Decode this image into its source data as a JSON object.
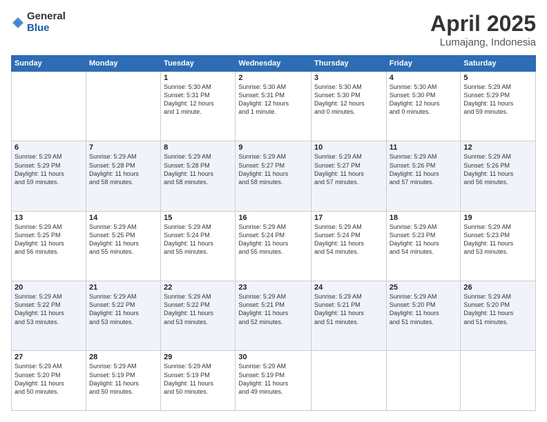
{
  "logo": {
    "general": "General",
    "blue": "Blue"
  },
  "title": "April 2025",
  "location": "Lumajang, Indonesia",
  "headers": [
    "Sunday",
    "Monday",
    "Tuesday",
    "Wednesday",
    "Thursday",
    "Friday",
    "Saturday"
  ],
  "weeks": [
    {
      "stripe": false,
      "days": [
        {
          "num": "",
          "info": ""
        },
        {
          "num": "",
          "info": ""
        },
        {
          "num": "1",
          "info": "Sunrise: 5:30 AM\nSunset: 5:31 PM\nDaylight: 12 hours\nand 1 minute."
        },
        {
          "num": "2",
          "info": "Sunrise: 5:30 AM\nSunset: 5:31 PM\nDaylight: 12 hours\nand 1 minute."
        },
        {
          "num": "3",
          "info": "Sunrise: 5:30 AM\nSunset: 5:30 PM\nDaylight: 12 hours\nand 0 minutes."
        },
        {
          "num": "4",
          "info": "Sunrise: 5:30 AM\nSunset: 5:30 PM\nDaylight: 12 hours\nand 0 minutes."
        },
        {
          "num": "5",
          "info": "Sunrise: 5:29 AM\nSunset: 5:29 PM\nDaylight: 11 hours\nand 59 minutes."
        }
      ]
    },
    {
      "stripe": true,
      "days": [
        {
          "num": "6",
          "info": "Sunrise: 5:29 AM\nSunset: 5:29 PM\nDaylight: 11 hours\nand 59 minutes."
        },
        {
          "num": "7",
          "info": "Sunrise: 5:29 AM\nSunset: 5:28 PM\nDaylight: 11 hours\nand 58 minutes."
        },
        {
          "num": "8",
          "info": "Sunrise: 5:29 AM\nSunset: 5:28 PM\nDaylight: 11 hours\nand 58 minutes."
        },
        {
          "num": "9",
          "info": "Sunrise: 5:29 AM\nSunset: 5:27 PM\nDaylight: 11 hours\nand 58 minutes."
        },
        {
          "num": "10",
          "info": "Sunrise: 5:29 AM\nSunset: 5:27 PM\nDaylight: 11 hours\nand 57 minutes."
        },
        {
          "num": "11",
          "info": "Sunrise: 5:29 AM\nSunset: 5:26 PM\nDaylight: 11 hours\nand 57 minutes."
        },
        {
          "num": "12",
          "info": "Sunrise: 5:29 AM\nSunset: 5:26 PM\nDaylight: 11 hours\nand 56 minutes."
        }
      ]
    },
    {
      "stripe": false,
      "days": [
        {
          "num": "13",
          "info": "Sunrise: 5:29 AM\nSunset: 5:25 PM\nDaylight: 11 hours\nand 56 minutes."
        },
        {
          "num": "14",
          "info": "Sunrise: 5:29 AM\nSunset: 5:25 PM\nDaylight: 11 hours\nand 55 minutes."
        },
        {
          "num": "15",
          "info": "Sunrise: 5:29 AM\nSunset: 5:24 PM\nDaylight: 11 hours\nand 55 minutes."
        },
        {
          "num": "16",
          "info": "Sunrise: 5:29 AM\nSunset: 5:24 PM\nDaylight: 11 hours\nand 55 minutes."
        },
        {
          "num": "17",
          "info": "Sunrise: 5:29 AM\nSunset: 5:24 PM\nDaylight: 11 hours\nand 54 minutes."
        },
        {
          "num": "18",
          "info": "Sunrise: 5:29 AM\nSunset: 5:23 PM\nDaylight: 11 hours\nand 54 minutes."
        },
        {
          "num": "19",
          "info": "Sunrise: 5:29 AM\nSunset: 5:23 PM\nDaylight: 11 hours\nand 53 minutes."
        }
      ]
    },
    {
      "stripe": true,
      "days": [
        {
          "num": "20",
          "info": "Sunrise: 5:29 AM\nSunset: 5:22 PM\nDaylight: 11 hours\nand 53 minutes."
        },
        {
          "num": "21",
          "info": "Sunrise: 5:29 AM\nSunset: 5:22 PM\nDaylight: 11 hours\nand 53 minutes."
        },
        {
          "num": "22",
          "info": "Sunrise: 5:29 AM\nSunset: 5:22 PM\nDaylight: 11 hours\nand 53 minutes."
        },
        {
          "num": "23",
          "info": "Sunrise: 5:29 AM\nSunset: 5:21 PM\nDaylight: 11 hours\nand 52 minutes."
        },
        {
          "num": "24",
          "info": "Sunrise: 5:29 AM\nSunset: 5:21 PM\nDaylight: 11 hours\nand 51 minutes."
        },
        {
          "num": "25",
          "info": "Sunrise: 5:29 AM\nSunset: 5:20 PM\nDaylight: 11 hours\nand 51 minutes."
        },
        {
          "num": "26",
          "info": "Sunrise: 5:29 AM\nSunset: 5:20 PM\nDaylight: 11 hours\nand 51 minutes."
        }
      ]
    },
    {
      "stripe": false,
      "days": [
        {
          "num": "27",
          "info": "Sunrise: 5:29 AM\nSunset: 5:20 PM\nDaylight: 11 hours\nand 50 minutes."
        },
        {
          "num": "28",
          "info": "Sunrise: 5:29 AM\nSunset: 5:19 PM\nDaylight: 11 hours\nand 50 minutes."
        },
        {
          "num": "29",
          "info": "Sunrise: 5:29 AM\nSunset: 5:19 PM\nDaylight: 11 hours\nand 50 minutes."
        },
        {
          "num": "30",
          "info": "Sunrise: 5:29 AM\nSunset: 5:19 PM\nDaylight: 11 hours\nand 49 minutes."
        },
        {
          "num": "",
          "info": ""
        },
        {
          "num": "",
          "info": ""
        },
        {
          "num": "",
          "info": ""
        }
      ]
    }
  ]
}
